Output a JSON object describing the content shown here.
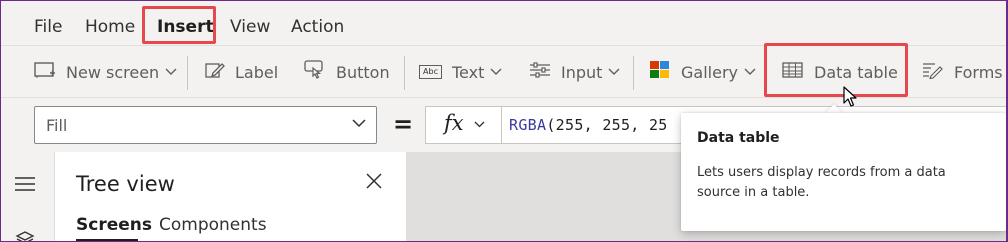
{
  "menu": {
    "items": [
      {
        "label": "File"
      },
      {
        "label": "Home"
      },
      {
        "label": "Insert",
        "active": true
      },
      {
        "label": "View"
      },
      {
        "label": "Action"
      }
    ]
  },
  "ribbon": {
    "new_screen": "New screen",
    "label": "Label",
    "button": "Button",
    "text": "Text",
    "input": "Input",
    "gallery": "Gallery",
    "data_table": "Data table",
    "forms": "Forms",
    "text_icon_glyph": "Abc"
  },
  "formula_bar": {
    "property": "Fill",
    "equals": "=",
    "fx": "fx",
    "formula_fn": "RGBA",
    "formula_args": "(255, 255, 25"
  },
  "tree_view": {
    "title": "Tree view",
    "tabs": [
      {
        "label": "Screens",
        "active": true
      },
      {
        "label": "Components"
      }
    ]
  },
  "tooltip": {
    "title": "Data table",
    "body": "Lets users display records from a data source in a table."
  },
  "colors": {
    "highlight": "#e5484d",
    "frame": "#6b2b87",
    "toolbar_bg": "#f3f2f1"
  },
  "icons": [
    "new-screen-icon",
    "label-icon",
    "button-icon",
    "text-icon",
    "input-icon",
    "gallery-icon",
    "data-table-icon",
    "forms-icon",
    "fx-icon",
    "close-icon",
    "hamburger-icon",
    "layers-icon",
    "pointer-cursor-icon"
  ]
}
